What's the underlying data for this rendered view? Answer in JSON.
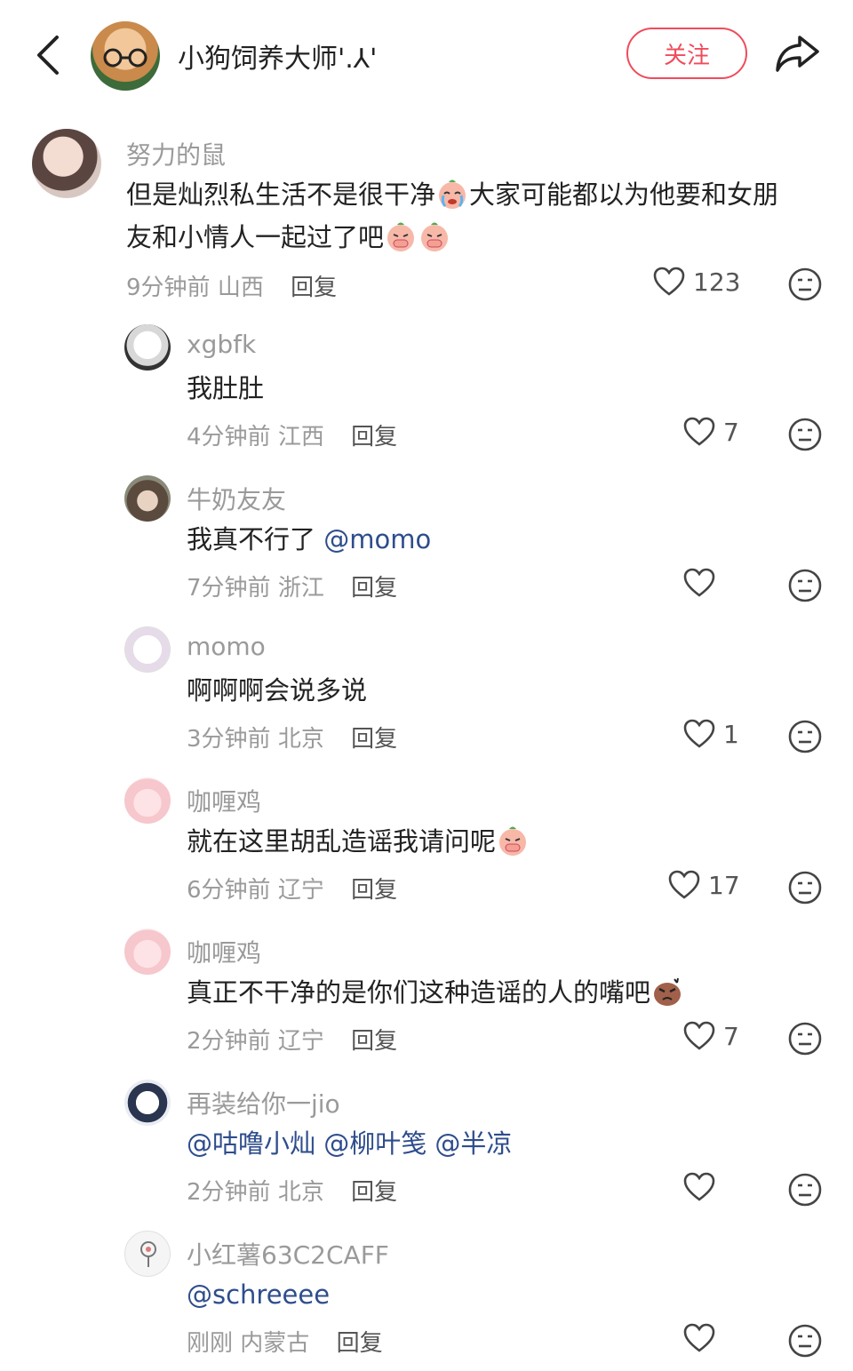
{
  "header": {
    "author_name": "小狗饲养大师'.⅄'",
    "follow_label": "关注",
    "back_icon": "chevron-left-icon",
    "share_icon": "share-arrow-icon"
  },
  "colors": {
    "accent": "#f04b5b",
    "mention": "#2e4d8c",
    "muted": "#9a9a9a"
  },
  "comments": [
    {
      "user": "努力的鼠",
      "line1a": "但是灿烈私生活不是很干净",
      "line1b": "大家可能都以为他要和女朋",
      "line2": "友和小情人一起过了吧",
      "time": "9分钟前",
      "location": "山西",
      "reply_label": "回复",
      "likes": "123"
    },
    {
      "user": "xgbfk",
      "text": "我肚肚",
      "time": "4分钟前",
      "location": "江西",
      "reply_label": "回复",
      "likes": "7"
    },
    {
      "user": "牛奶友友",
      "text": "我真不行了 ",
      "mention": "@momo",
      "time": "7分钟前",
      "location": "浙江",
      "reply_label": "回复",
      "likes": ""
    },
    {
      "user": "momo",
      "text": "啊啊啊会说多说",
      "time": "3分钟前",
      "location": "北京",
      "reply_label": "回复",
      "likes": "1"
    },
    {
      "user": "咖喱鸡",
      "text": "就在这里胡乱造谣我请问呢",
      "time": "6分钟前",
      "location": "辽宁",
      "reply_label": "回复",
      "likes": "17"
    },
    {
      "user": "咖喱鸡",
      "text": "真正不干净的是你们这种造谣的人的嘴吧",
      "time": "2分钟前",
      "location": "辽宁",
      "reply_label": "回复",
      "likes": "7"
    },
    {
      "user": "再装给你一jio",
      "mentions": "@咕噜小灿 @柳叶笺 @半凉",
      "time": "2分钟前",
      "location": "北京",
      "reply_label": "回复",
      "likes": ""
    },
    {
      "user": "小红薯63C2CAFF",
      "mentions": "@schreeee",
      "time": "刚刚",
      "location": "内蒙古",
      "reply_label": "回复",
      "likes": ""
    }
  ]
}
